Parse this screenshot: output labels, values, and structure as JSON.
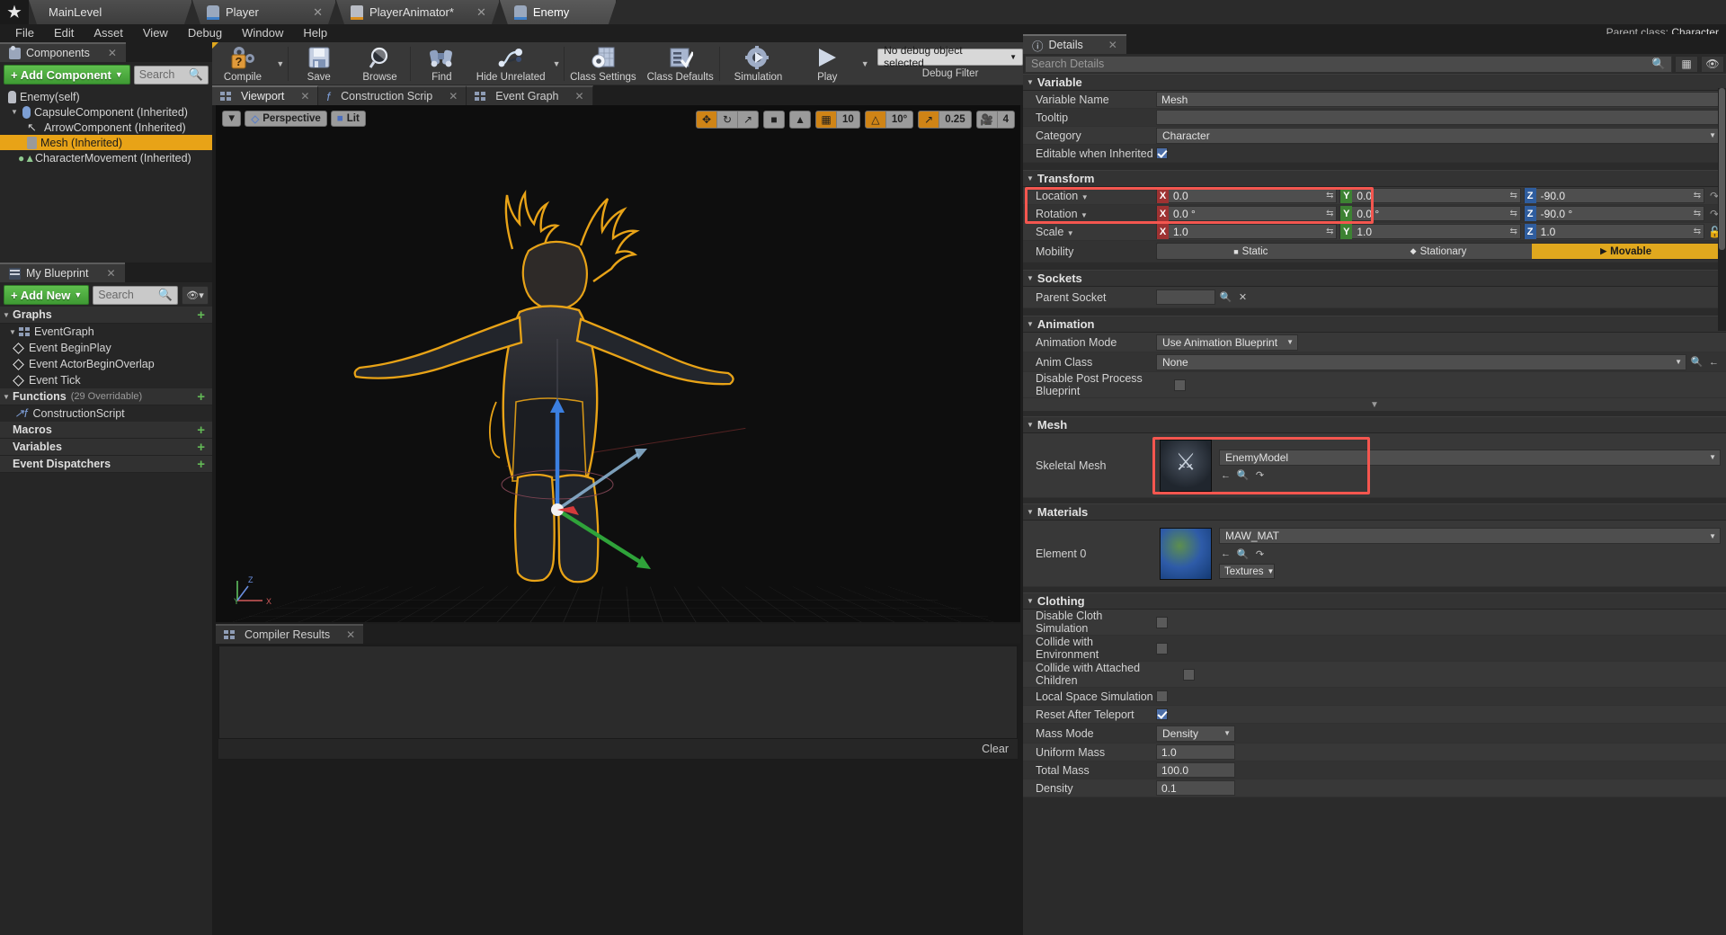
{
  "titlebar": {
    "tabs": [
      {
        "label": "MainLevel",
        "icon": "level-icon",
        "closable": false,
        "active": false
      },
      {
        "label": "Player",
        "icon": "blueprint-pawn-icon",
        "closable": true,
        "active": false
      },
      {
        "label": "PlayerAnimator*",
        "icon": "anim-blueprint-icon",
        "closable": true,
        "active": false
      },
      {
        "label": "Enemy",
        "icon": "blueprint-pawn-icon",
        "closable": false,
        "active": true
      }
    ]
  },
  "menubar": {
    "items": [
      "File",
      "Edit",
      "Asset",
      "View",
      "Debug",
      "Window",
      "Help"
    ]
  },
  "parent_class": {
    "label": "Parent class:",
    "value": "Character"
  },
  "components_panel": {
    "tab_label": "Components",
    "add_button": "+ Add Component",
    "search_placeholder": "Search",
    "tree": [
      {
        "label": "Enemy(self)",
        "icon": "pawn-icon",
        "depth": 0,
        "selected": false,
        "expandable": false
      },
      {
        "label": "CapsuleComponent (Inherited)",
        "icon": "capsule-icon",
        "depth": 1,
        "selected": false,
        "expandable": true
      },
      {
        "label": "ArrowComponent (Inherited)",
        "icon": "arrow-icon",
        "depth": 2,
        "selected": false,
        "expandable": false
      },
      {
        "label": "Mesh (Inherited)",
        "icon": "mesh-icon",
        "depth": 2,
        "selected": true,
        "expandable": false
      },
      {
        "label": "CharacterMovement (Inherited)",
        "icon": "movement-icon",
        "depth": 1,
        "selected": false,
        "expandable": false
      }
    ]
  },
  "myblueprint_panel": {
    "tab_label": "My Blueprint",
    "add_button": "+ Add New",
    "search_placeholder": "Search",
    "sections": [
      {
        "title": "Graphs",
        "sub": "",
        "items": [
          {
            "label": "EventGraph",
            "icon": "graph-icon",
            "depth": 0
          },
          {
            "label": "Event BeginPlay",
            "icon": "event-node-icon",
            "depth": 1
          },
          {
            "label": "Event ActorBeginOverlap",
            "icon": "event-node-icon",
            "depth": 1
          },
          {
            "label": "Event Tick",
            "icon": "event-node-icon",
            "depth": 1
          }
        ]
      },
      {
        "title": "Functions",
        "sub": "(29 Overridable)",
        "items": [
          {
            "label": "ConstructionScript",
            "icon": "function-icon",
            "depth": 0
          }
        ]
      },
      {
        "title": "Macros",
        "sub": "",
        "items": []
      },
      {
        "title": "Variables",
        "sub": "",
        "items": []
      },
      {
        "title": "Event Dispatchers",
        "sub": "",
        "items": []
      }
    ]
  },
  "toolbar": {
    "buttons": [
      {
        "label": "Compile",
        "icon": "compile-question-icon",
        "has_caret": true
      },
      {
        "label": "Save",
        "icon": "save-floppy-icon",
        "has_caret": false
      },
      {
        "label": "Browse",
        "icon": "browse-magnifier-icon",
        "has_caret": false
      },
      {
        "label": "Find",
        "icon": "find-binoculars-icon",
        "has_caret": false
      },
      {
        "label": "Hide Unrelated",
        "icon": "hide-unrelated-icon",
        "has_caret": true
      },
      {
        "label": "Class Settings",
        "icon": "class-settings-gear-icon",
        "has_caret": false
      },
      {
        "label": "Class Defaults",
        "icon": "class-defaults-icon",
        "has_caret": false
      },
      {
        "label": "Simulation",
        "icon": "simulation-icon",
        "has_caret": false
      },
      {
        "label": "Play",
        "icon": "play-triangle-icon",
        "has_caret": true
      }
    ],
    "debug_object": "No debug object selected",
    "debug_filter_label": "Debug Filter"
  },
  "viewport": {
    "tabs": [
      {
        "label": "Viewport",
        "icon": "viewport-grid-icon",
        "active": true,
        "closable": true
      },
      {
        "label": "Construction Scrip",
        "icon": "function-icon",
        "active": false,
        "closable": true
      },
      {
        "label": "Event Graph",
        "icon": "graph-icon",
        "active": false,
        "closable": true
      }
    ],
    "view_mode": "Perspective",
    "lighting_mode": "Lit",
    "transform_tools": [
      "translate-gizmo-icon",
      "rotate-gizmo-icon",
      "scale-gizmo-icon"
    ],
    "active_transform_tool": "translate-gizmo-icon",
    "coord_system": "world-cube-icon",
    "surface_snap": "surface-snap-icon",
    "grid_snap_value": "10",
    "angle_snap_value": "10°",
    "scale_snap_value": "0.25",
    "camera_speed_value": "4"
  },
  "compiler_results": {
    "tab_label": "Compiler Results",
    "messages": [],
    "clear_label": "Clear"
  },
  "details": {
    "tab_label": "Details",
    "search_placeholder": "Search Details",
    "categories": [
      {
        "name": "Variable",
        "rows": [
          {
            "label": "Variable Name",
            "type": "text",
            "value": "Mesh"
          },
          {
            "label": "Tooltip",
            "type": "text",
            "value": ""
          },
          {
            "label": "Category",
            "type": "dropdown",
            "value": "Character"
          },
          {
            "label": "Editable when Inherited",
            "type": "checkbox",
            "value": true
          }
        ]
      },
      {
        "name": "Transform",
        "rows": [
          {
            "label": "Location",
            "type": "vector",
            "x": "0.0",
            "y": "0.0",
            "z": "-90.0",
            "highlighted": true
          },
          {
            "label": "Rotation",
            "type": "vector",
            "x": "0.0 °",
            "y": "0.0 °",
            "z": "-90.0 °",
            "highlighted": true
          },
          {
            "label": "Scale",
            "type": "vector",
            "x": "1.0",
            "y": "1.0",
            "z": "1.0",
            "highlighted": false
          },
          {
            "label": "Mobility",
            "type": "mobility",
            "options": [
              "Static",
              "Stationary",
              "Movable"
            ],
            "value": "Movable"
          }
        ]
      },
      {
        "name": "Sockets",
        "rows": [
          {
            "label": "Parent Socket",
            "type": "socket",
            "value": ""
          }
        ]
      },
      {
        "name": "Animation",
        "rows": [
          {
            "label": "Animation Mode",
            "type": "dropdown",
            "value": "Use Animation Blueprint"
          },
          {
            "label": "Anim Class",
            "type": "asset-dropdown",
            "value": "None"
          },
          {
            "label": "Disable Post Process Blueprint",
            "type": "checkbox",
            "value": false
          }
        ]
      },
      {
        "name": "Mesh",
        "rows": [
          {
            "label": "Skeletal Mesh",
            "type": "asset",
            "value": "EnemyModel",
            "thumbnail": "skeletal-mesh-thumbnail",
            "highlighted": true
          }
        ]
      },
      {
        "name": "Materials",
        "rows": [
          {
            "label": "Element 0",
            "type": "material",
            "value": "MAW_MAT",
            "thumbnail": "material-sphere-thumbnail",
            "extra_button": "Textures"
          }
        ]
      },
      {
        "name": "Clothing",
        "rows": [
          {
            "label": "Disable Cloth Simulation",
            "type": "checkbox",
            "value": false
          },
          {
            "label": "Collide with Environment",
            "type": "checkbox",
            "value": false
          },
          {
            "label": "Collide with Attached Children",
            "type": "checkbox",
            "value": false
          },
          {
            "label": "Local Space Simulation",
            "type": "checkbox",
            "value": false
          },
          {
            "label": "Reset After Teleport",
            "type": "checkbox",
            "value": true
          },
          {
            "label": "Mass Mode",
            "type": "dropdown",
            "value": "Density"
          },
          {
            "label": "Uniform Mass",
            "type": "text",
            "value": "1.0"
          },
          {
            "label": "Total Mass",
            "type": "text",
            "value": "100.0"
          },
          {
            "label": "Density",
            "type": "text",
            "value": "0.1"
          }
        ]
      }
    ]
  },
  "colors": {
    "highlight_red": "#f4564f",
    "selection_orange": "#e8a317",
    "accent_green": "#4fa83d",
    "axis_x": "#9e3232",
    "axis_y": "#3d8233",
    "axis_z": "#2f5d9e"
  }
}
